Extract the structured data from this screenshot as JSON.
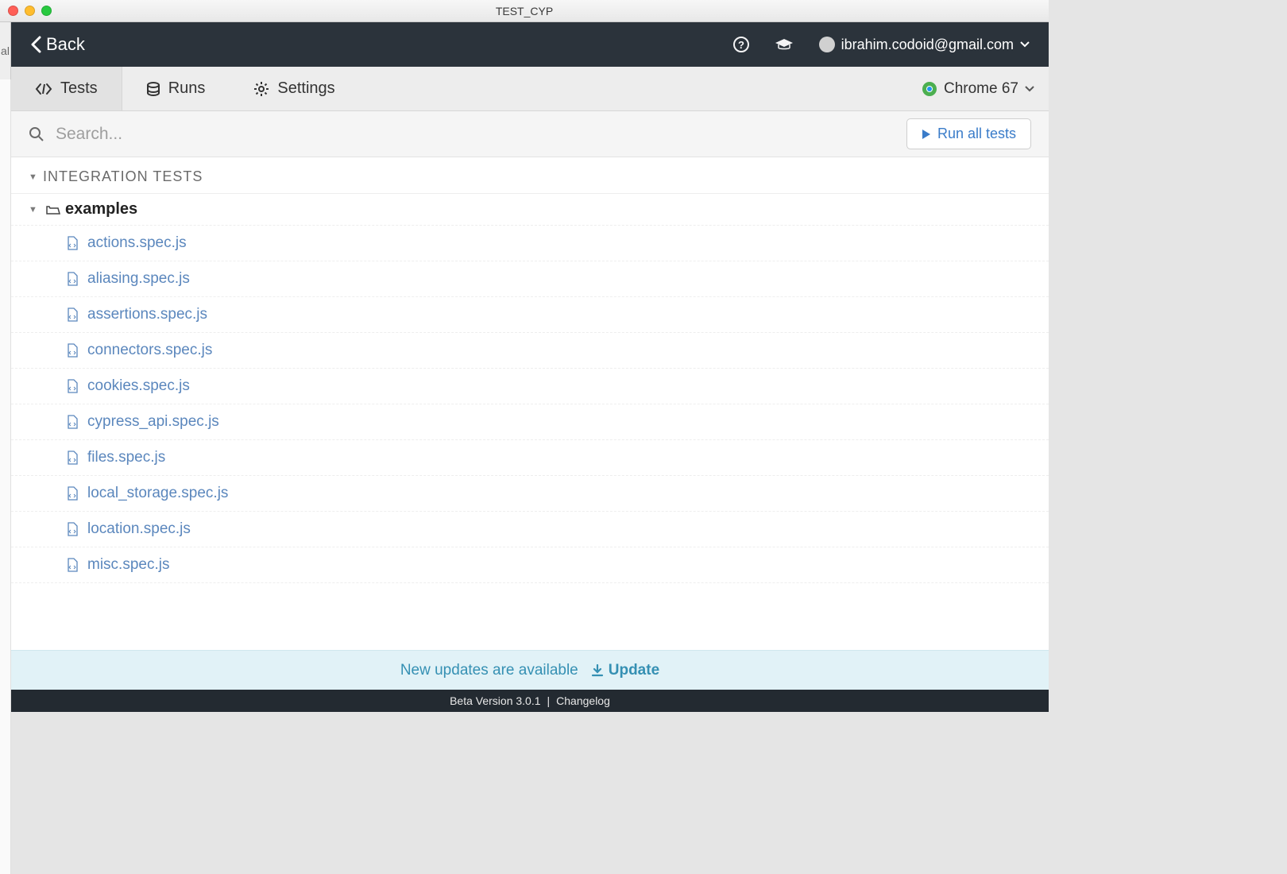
{
  "window": {
    "title": "TEST_CYP"
  },
  "topbar": {
    "back_label": "Back",
    "user_email": "ibrahim.codoid@gmail.com"
  },
  "tabs": {
    "tests": "Tests",
    "runs": "Runs",
    "settings": "Settings",
    "browser": "Chrome 67"
  },
  "search": {
    "placeholder": "Search...",
    "run_all_label": "Run all tests"
  },
  "tree": {
    "section_title": "INTEGRATION TESTS",
    "folder": "examples",
    "files": [
      "actions.spec.js",
      "aliasing.spec.js",
      "assertions.spec.js",
      "connectors.spec.js",
      "cookies.spec.js",
      "cypress_api.spec.js",
      "files.spec.js",
      "local_storage.spec.js",
      "location.spec.js",
      "misc.spec.js"
    ]
  },
  "banner": {
    "message": "New updates are available",
    "action": "Update"
  },
  "footer": {
    "version": "Beta Version 3.0.1",
    "changelog": "Changelog"
  }
}
